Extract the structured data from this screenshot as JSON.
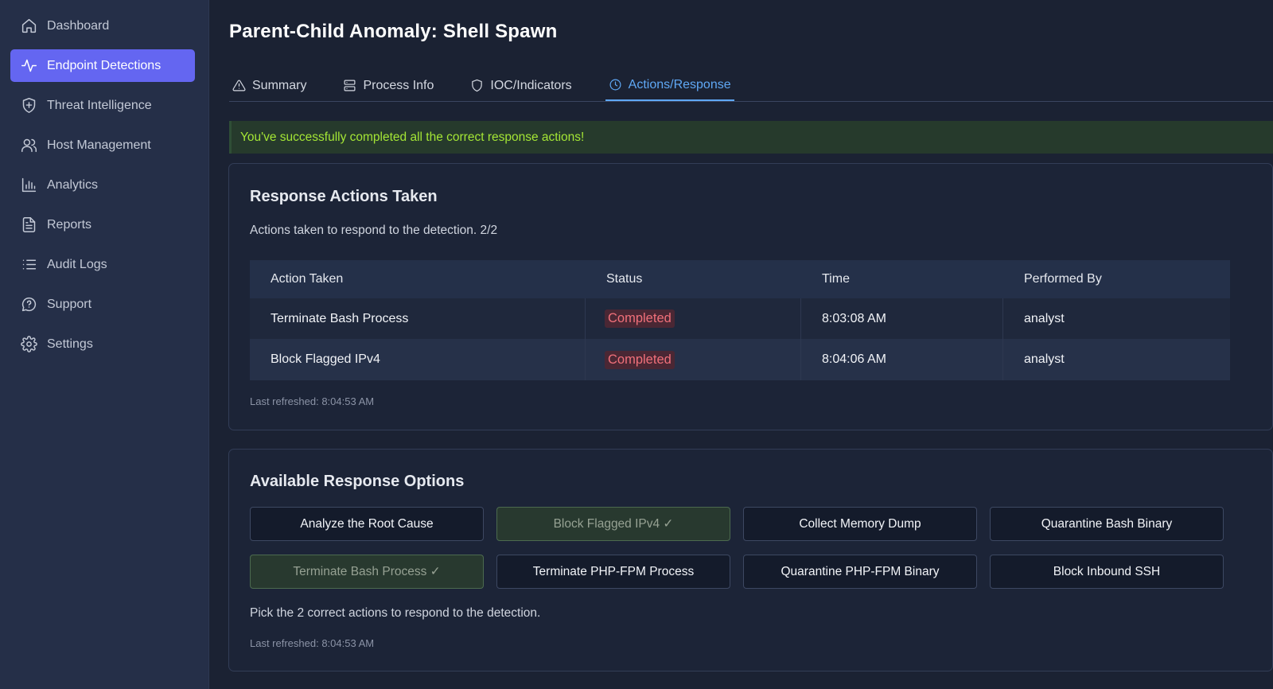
{
  "sidebar": {
    "items": [
      {
        "label": "Dashboard",
        "icon": "home-icon"
      },
      {
        "label": "Endpoint Detections",
        "icon": "activity-icon",
        "active": true
      },
      {
        "label": "Threat Intelligence",
        "icon": "shield-plus-icon"
      },
      {
        "label": "Host Management",
        "icon": "users-icon"
      },
      {
        "label": "Analytics",
        "icon": "bar-chart-icon"
      },
      {
        "label": "Reports",
        "icon": "file-text-icon"
      },
      {
        "label": "Audit Logs",
        "icon": "list-icon"
      },
      {
        "label": "Support",
        "icon": "chat-help-icon"
      },
      {
        "label": "Settings",
        "icon": "gear-icon"
      }
    ],
    "active_color": "#6466f1"
  },
  "page": {
    "title": "Parent-Child Anomaly: Shell Spawn"
  },
  "tabs": [
    {
      "label": "Summary",
      "icon": "warning-triangle-icon"
    },
    {
      "label": "Process Info",
      "icon": "server-icon"
    },
    {
      "label": "IOC/Indicators",
      "icon": "shield-icon"
    },
    {
      "label": "Actions/Response",
      "icon": "clock-icon",
      "active": true
    }
  ],
  "banner": {
    "text": "You've successfully completed all the correct response actions!",
    "color": "#a4e635"
  },
  "actions_taken": {
    "title": "Response Actions Taken",
    "subtitle": "Actions taken to respond to the detection. 2/2",
    "columns": [
      "Action Taken",
      "Status",
      "Time",
      "Performed By"
    ],
    "rows": [
      {
        "action": "Terminate Bash Process",
        "status": "Completed",
        "time": "8:03:08 AM",
        "by": "analyst"
      },
      {
        "action": "Block Flagged IPv4",
        "status": "Completed",
        "time": "8:04:06 AM",
        "by": "analyst"
      }
    ],
    "last_refreshed": "Last refreshed: 8:04:53 AM"
  },
  "options": {
    "title": "Available Response Options",
    "buttons": [
      {
        "label": "Analyze the Root Cause",
        "done": false
      },
      {
        "label": "Block Flagged IPv4 ✓",
        "done": true
      },
      {
        "label": "Collect Memory Dump",
        "done": false
      },
      {
        "label": "Quarantine Bash Binary",
        "done": false
      },
      {
        "label": "Terminate Bash Process ✓",
        "done": true
      },
      {
        "label": "Terminate PHP-FPM Process",
        "done": false
      },
      {
        "label": "Quarantine PHP-FPM Binary",
        "done": false
      },
      {
        "label": "Block Inbound SSH",
        "done": false
      }
    ],
    "hint": "Pick the 2 correct actions to respond to the detection.",
    "last_refreshed": "Last refreshed: 8:04:53 AM"
  }
}
